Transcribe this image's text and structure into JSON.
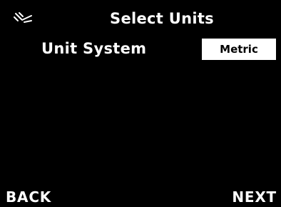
{
  "header": {
    "icon": "satellite-off-icon",
    "title": "Select Units"
  },
  "settings": {
    "unit_system_label": "Unit System",
    "unit_system_value": "Metric"
  },
  "softkeys": {
    "back_label": "BACK",
    "next_label": "NEXT"
  },
  "colors": {
    "background": "#000000",
    "text": "#ffffff",
    "value_box_bg": "#ffffff",
    "value_box_text": "#000000"
  }
}
